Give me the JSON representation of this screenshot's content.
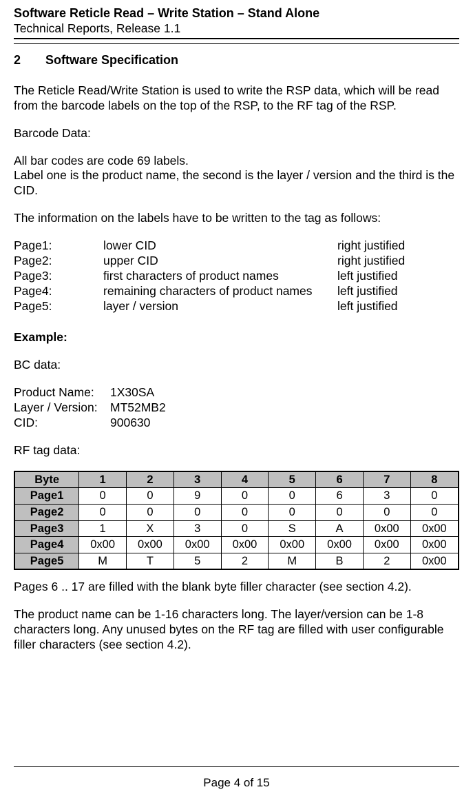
{
  "header": {
    "title": "Software Reticle Read – Write Station – Stand Alone",
    "subtitle": "Technical Reports, Release 1.1"
  },
  "section": {
    "number": "2",
    "title": "Software Specification"
  },
  "intro": "The Reticle Read/Write Station is used to write the RSP data, which will be read from the barcode labels on the top of the RSP, to the RF tag of the RSP.",
  "barcode_heading": "Barcode Data:",
  "barcode_desc1": "All bar codes are code 69 labels.",
  "barcode_desc2": "Label one is the product name, the second is the layer / version and the third is the CID.",
  "label_instr": "The information on the labels have to be written to the tag as follows:",
  "pages": [
    {
      "name": "Page1:",
      "desc": "lower CID",
      "just": "right justified"
    },
    {
      "name": "Page2:",
      "desc": "upper CID",
      "just": "right justified"
    },
    {
      "name": "Page3:",
      "desc": "first characters of product names",
      "just": "left justified"
    },
    {
      "name": "Page4:",
      "desc": "remaining characters of product names",
      "just": "left justified"
    },
    {
      "name": "Page5:",
      "desc": "layer / version",
      "just": "left justified"
    }
  ],
  "example_heading": "Example:",
  "bc_data_heading": "BC data:",
  "bc": [
    {
      "label": "Product Name:",
      "value": "1X30SA"
    },
    {
      "label": "Layer / Version:",
      "value": "MT52MB2"
    },
    {
      "label": "CID:",
      "value": "900630"
    }
  ],
  "rf_heading": "RF tag data:",
  "chart_data": {
    "type": "table",
    "col_header": "Byte",
    "columns": [
      "1",
      "2",
      "3",
      "4",
      "5",
      "6",
      "7",
      "8"
    ],
    "rows": [
      {
        "name": "Page1",
        "cells": [
          "0",
          "0",
          "9",
          "0",
          "0",
          "6",
          "3",
          "0"
        ]
      },
      {
        "name": "Page2",
        "cells": [
          "0",
          "0",
          "0",
          "0",
          "0",
          "0",
          "0",
          "0"
        ]
      },
      {
        "name": "Page3",
        "cells": [
          "1",
          "X",
          "3",
          "0",
          "S",
          "A",
          "0x00",
          "0x00"
        ]
      },
      {
        "name": "Page4",
        "cells": [
          "0x00",
          "0x00",
          "0x00",
          "0x00",
          "0x00",
          "0x00",
          "0x00",
          "0x00"
        ]
      },
      {
        "name": "Page5",
        "cells": [
          "M",
          "T",
          "5",
          "2",
          "M",
          "B",
          "2",
          "0x00"
        ]
      }
    ]
  },
  "after1": "Pages 6 .. 17 are filled with the blank byte filler character (see section 4.2).",
  "after2": "The product name can be 1-16 characters long. The layer/version can be 1-8 characters long. Any unused bytes on the RF tag are filled with user configurable filler characters (see section 4.2).",
  "footer": "Page 4 of 15"
}
